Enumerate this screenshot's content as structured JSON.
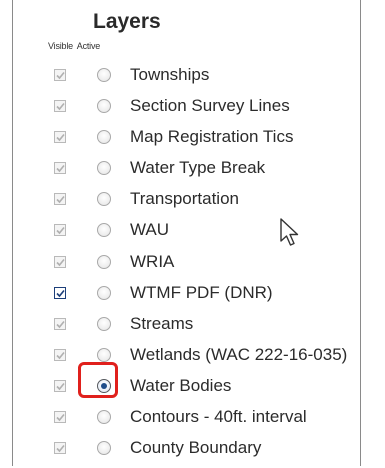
{
  "panel": {
    "title": "Layers",
    "column_headers": {
      "visible": "Visible",
      "active": "Active"
    }
  },
  "layers": [
    {
      "label": "Townships",
      "visible_checked": true,
      "enabled": false,
      "active": false
    },
    {
      "label": "Section Survey Lines",
      "visible_checked": true,
      "enabled": false,
      "active": false
    },
    {
      "label": "Map Registration Tics",
      "visible_checked": true,
      "enabled": false,
      "active": false
    },
    {
      "label": "Water Type Break",
      "visible_checked": true,
      "enabled": false,
      "active": false
    },
    {
      "label": "Transportation",
      "visible_checked": true,
      "enabled": false,
      "active": false
    },
    {
      "label": "WAU",
      "visible_checked": true,
      "enabled": false,
      "active": false
    },
    {
      "label": "WRIA",
      "visible_checked": true,
      "enabled": false,
      "active": false
    },
    {
      "label": "WTMF PDF (DNR)",
      "visible_checked": true,
      "enabled": true,
      "active": false
    },
    {
      "label": "Streams",
      "visible_checked": true,
      "enabled": false,
      "active": false
    },
    {
      "label": "Wetlands (WAC 222-16-035)",
      "visible_checked": true,
      "enabled": false,
      "active": false
    },
    {
      "label": "Water Bodies",
      "visible_checked": true,
      "enabled": false,
      "active": true
    },
    {
      "label": "Contours - 40ft. interval",
      "visible_checked": true,
      "enabled": false,
      "active": false
    },
    {
      "label": "County Boundary",
      "visible_checked": true,
      "enabled": false,
      "active": false
    }
  ],
  "colors": {
    "highlight": "#e0201c",
    "selected_radio": "#1e4d8a",
    "checkmark_disabled": "#b0b0b0",
    "checkmark_enabled": "#1d3f7a"
  }
}
